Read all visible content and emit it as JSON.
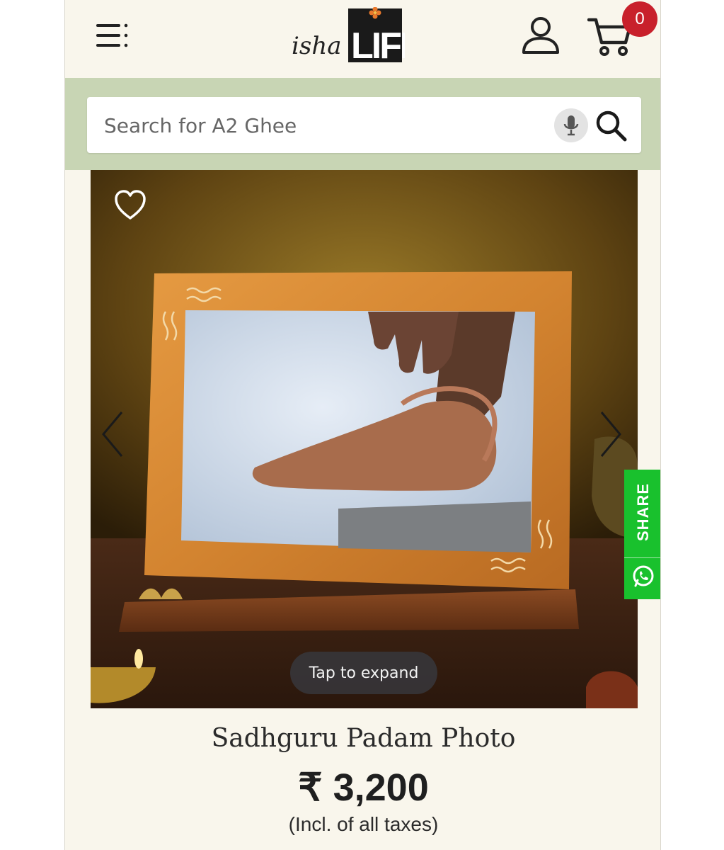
{
  "header": {
    "logo_text_isha": "isha",
    "logo_text_life": "LIFE",
    "cart_count": "0"
  },
  "search": {
    "placeholder": "Search for A2 Ghee"
  },
  "gallery": {
    "expand_label": "Tap to expand"
  },
  "share": {
    "label": "SHARE"
  },
  "product": {
    "title": "Sadhguru Padam Photo",
    "price": "₹ 3,200",
    "tax_note": "(Incl. of all taxes)"
  },
  "colors": {
    "search_band": "#c8d5b4",
    "badge": "#c8202b",
    "share": "#19c12d",
    "page_bg": "#f9f6ec"
  }
}
